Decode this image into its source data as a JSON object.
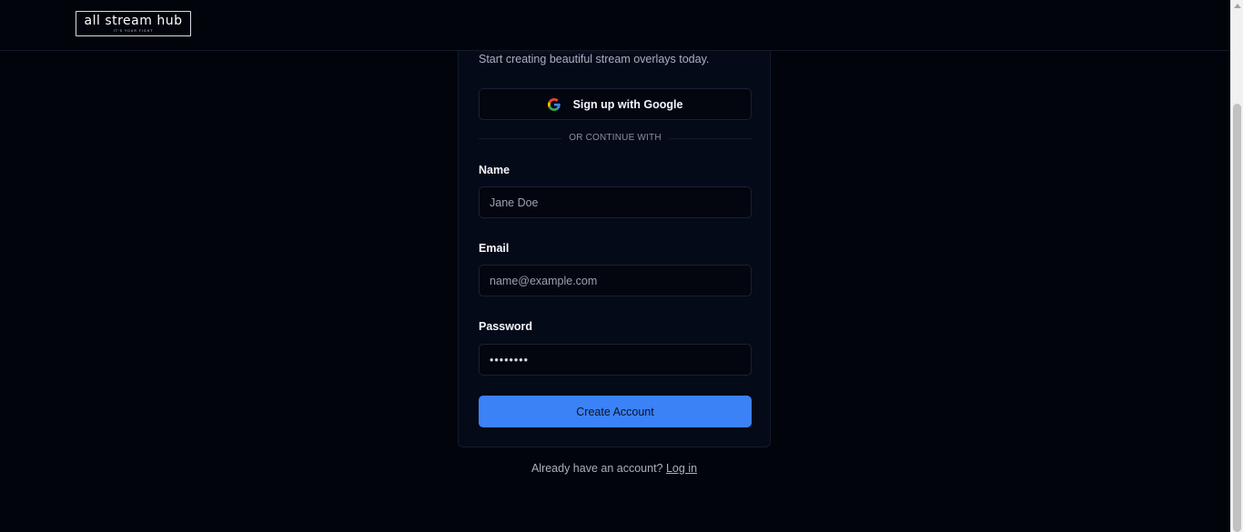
{
  "header": {
    "logo_text": "all stream hub",
    "logo_tagline": "IT'S YOUR FIGHT"
  },
  "signup_card": {
    "subtitle": "Start creating beautiful stream overlays today.",
    "google_button_label": "Sign up with Google",
    "divider_text": "OR CONTINUE WITH",
    "name": {
      "label": "Name",
      "placeholder": "Jane Doe"
    },
    "email": {
      "label": "Email",
      "placeholder": "name@example.com"
    },
    "password": {
      "label": "Password",
      "value": "••••••••"
    },
    "submit_label": "Create Account"
  },
  "footer": {
    "prompt": "Already have an account?",
    "login_link": "Log in"
  },
  "icons": {
    "google": "google-logo-icon",
    "scroll_up": "scroll-up-arrow-icon"
  },
  "colors": {
    "background": "#02040c",
    "card": "#050a18",
    "accent": "#3b82f6"
  }
}
